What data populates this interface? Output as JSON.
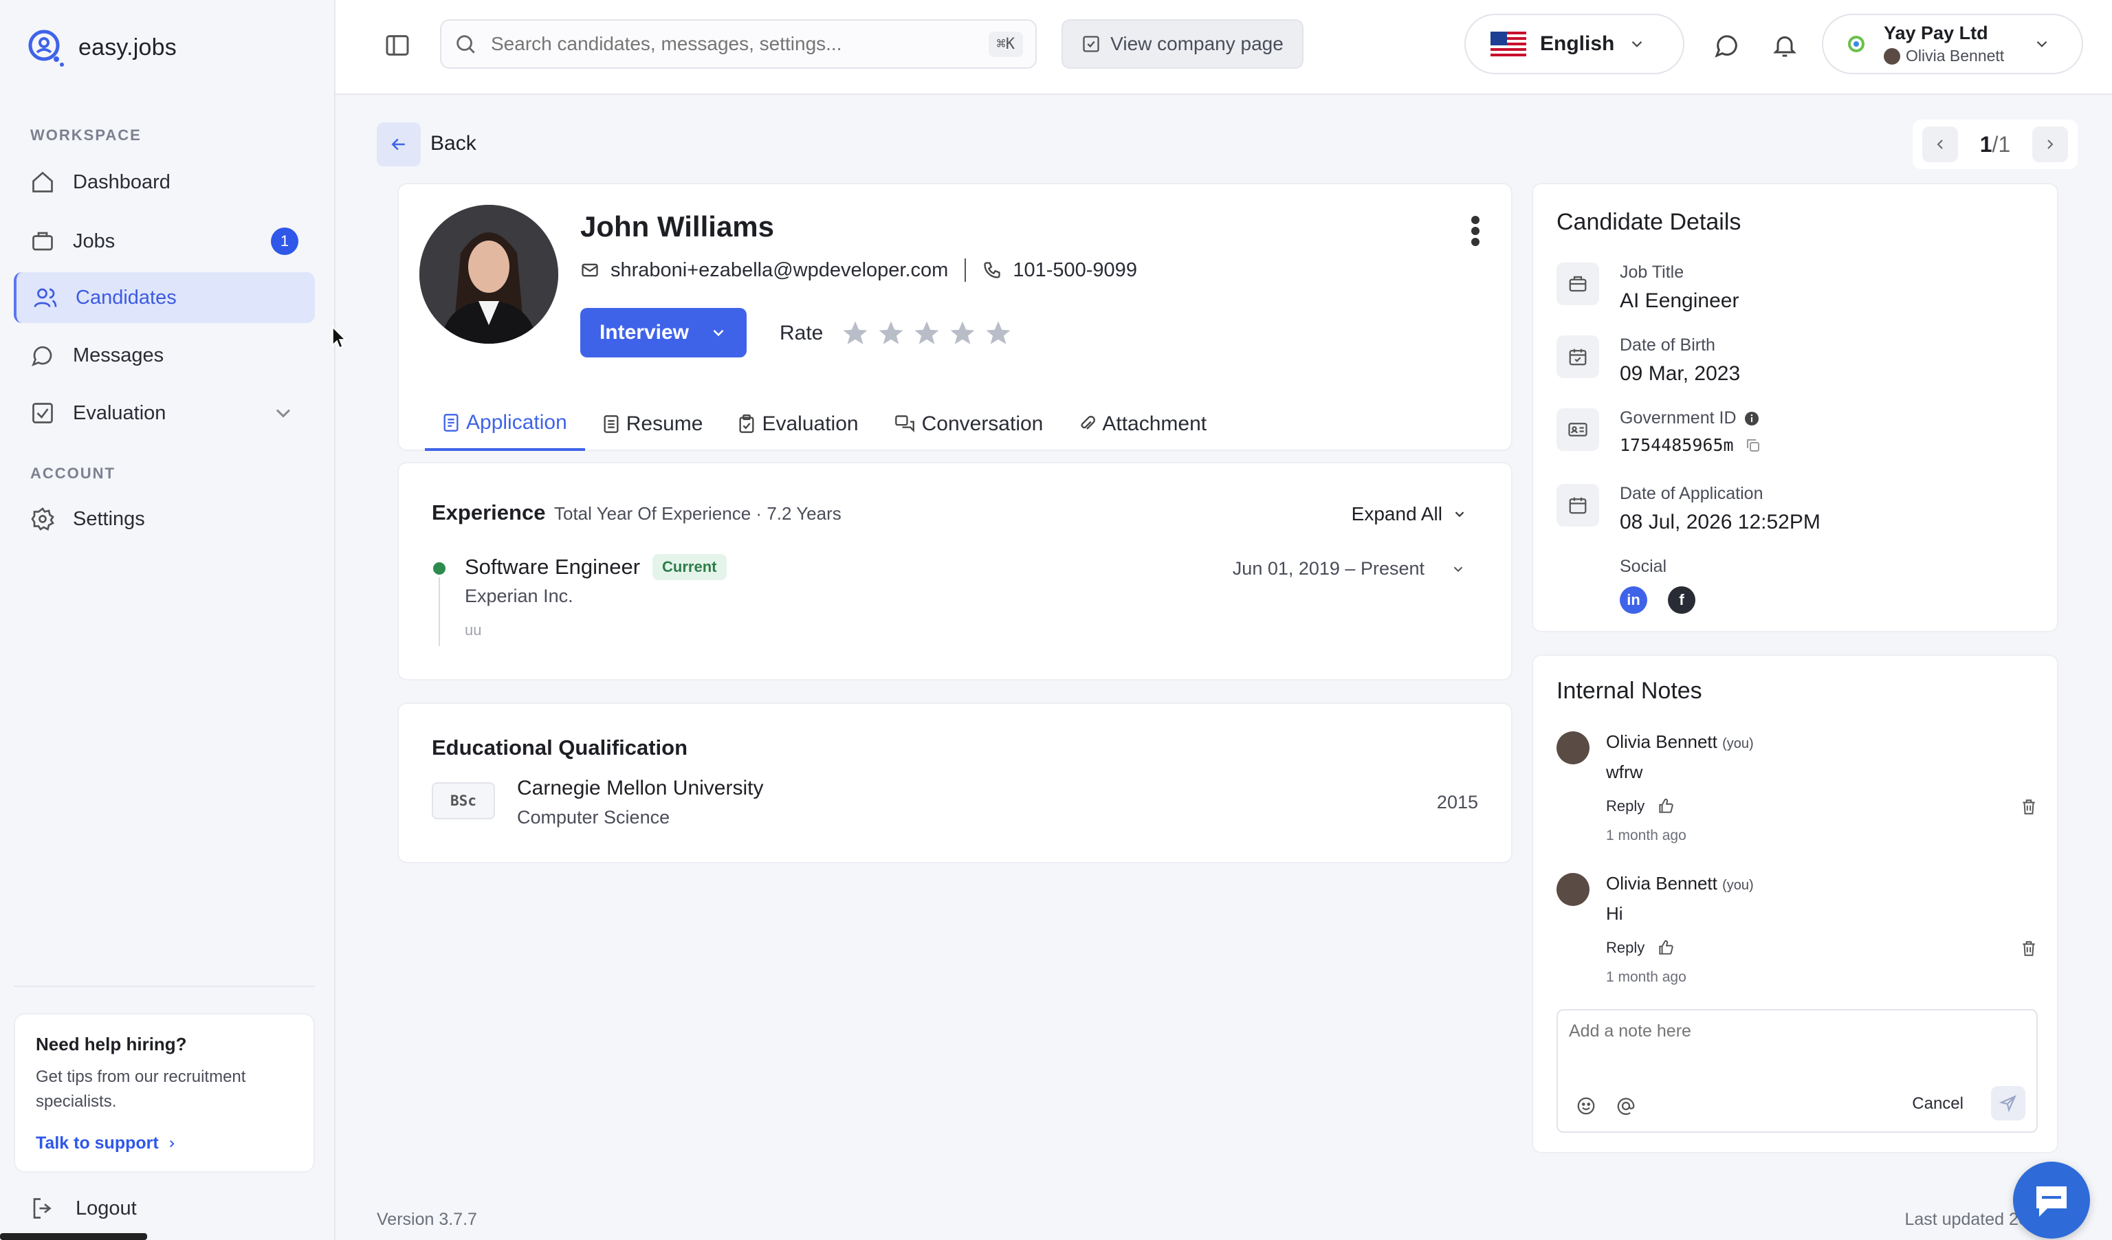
{
  "app": {
    "name": "easy.jobs"
  },
  "sidebar": {
    "workspace_label": "WORKSPACE",
    "account_label": "ACCOUNT",
    "items": [
      {
        "label": "Dashboard",
        "icon": "home-icon"
      },
      {
        "label": "Jobs",
        "icon": "briefcase-icon",
        "badge": "1"
      },
      {
        "label": "Candidates",
        "icon": "users-icon",
        "active": true
      },
      {
        "label": "Messages",
        "icon": "chat-icon"
      },
      {
        "label": "Evaluation",
        "icon": "checklist-icon",
        "expandable": true
      }
    ],
    "settings_label": "Settings",
    "help": {
      "title": "Need help hiring?",
      "desc": "Get tips from our recruitment specialists.",
      "link": "Talk to support"
    },
    "logout_label": "Logout"
  },
  "topbar": {
    "search_placeholder": "Search candidates, messages, settings...",
    "search_shortcut": "⌘K",
    "company_page_label": "View company page",
    "language": "English",
    "company_name": "Yay Pay Ltd",
    "user_name": "Olivia Bennett"
  },
  "nav": {
    "back_label": "Back",
    "pager_current": "1",
    "pager_total": "/1"
  },
  "candidate": {
    "name": "John Williams",
    "email": "shraboni+ezabella@wpdeveloper.com",
    "phone": "101-500-9099",
    "stage": "Interview",
    "rate_label": "Rate",
    "rating": 0,
    "rating_max": 5
  },
  "tabs": [
    {
      "label": "Application",
      "active": true
    },
    {
      "label": "Resume"
    },
    {
      "label": "Evaluation"
    },
    {
      "label": "Conversation"
    },
    {
      "label": "Attachment"
    }
  ],
  "experience": {
    "title": "Experience",
    "total_label": "Total Year Of Experience",
    "total_value": "7.2 Years",
    "expand_label": "Expand All",
    "jobs": [
      {
        "title": "Software Engineer",
        "badge": "Current",
        "company": "Experian Inc.",
        "dates": "Jun 01, 2019 – Present",
        "snippet": "uu"
      }
    ]
  },
  "education": {
    "title": "Educational Qualification",
    "items": [
      {
        "degree": "BSc",
        "institution": "Carnegie Mellon University",
        "field": "Computer Science",
        "year": "2015"
      }
    ]
  },
  "details": {
    "title": "Candidate Details",
    "job_title_label": "Job Title",
    "job_title": "AI Eengineer",
    "dob_label": "Date of Birth",
    "dob": "09 Mar, 2023",
    "gov_id_label": "Government ID",
    "gov_id": "1754485965m",
    "applied_label": "Date of Application",
    "applied": "08 Jul, 2026 12:52PM",
    "social_label": "Social"
  },
  "notes": {
    "title": "Internal Notes",
    "items": [
      {
        "author": "Olivia Bennett",
        "you": "(you)",
        "text": "wfrw",
        "reply": "Reply",
        "time": "1 month ago"
      },
      {
        "author": "Olivia Bennett",
        "you": "(you)",
        "text": "Hi",
        "reply": "Reply",
        "time": "1 month ago"
      }
    ],
    "input_placeholder": "Add a note here",
    "cancel_label": "Cancel"
  },
  "footer": {
    "version": "Version 3.7.7",
    "last_updated": "Last updated 20-0"
  },
  "colors": {
    "accent": "#3f63e8",
    "active_nav_bg": "#dfe5fb",
    "current_green": "#2e8b4e"
  }
}
